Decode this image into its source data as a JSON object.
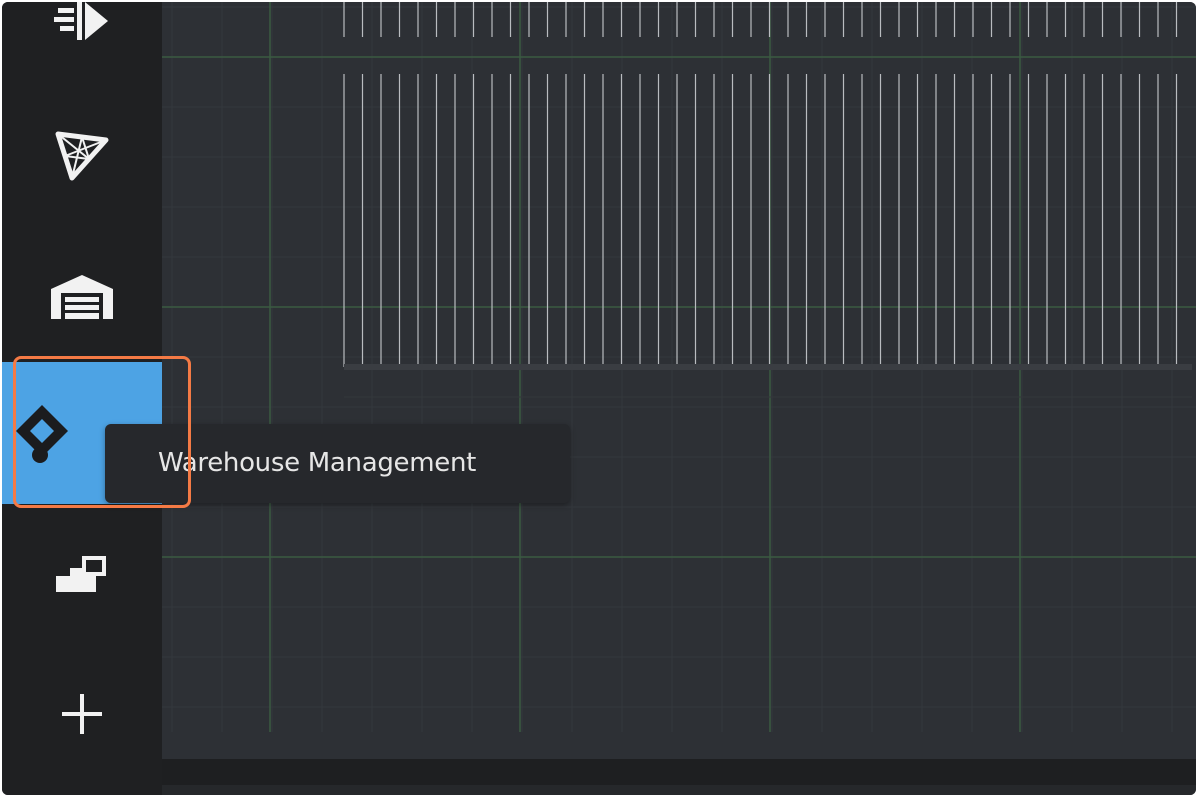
{
  "sidebar": {
    "items": [
      {
        "name": "nav-item-flow",
        "icon": "flow-arrow-icon",
        "active": false
      },
      {
        "name": "nav-item-mesh",
        "icon": "triangle-mesh-icon",
        "active": false
      },
      {
        "name": "nav-item-warehouse",
        "icon": "warehouse-icon",
        "active": false
      },
      {
        "name": "nav-item-warehouse-management",
        "icon": "diamond-connector-icon",
        "active": true
      },
      {
        "name": "nav-item-blocks",
        "icon": "blocks-icon",
        "active": false
      },
      {
        "name": "nav-item-add",
        "icon": "plus-icon",
        "active": false
      }
    ]
  },
  "tooltip": {
    "text": "Warehouse Management"
  },
  "colors": {
    "sidebar_bg": "#1f2022",
    "canvas_bg": "#2d3035",
    "active_item": "#4da3e4",
    "highlight": "#f47a45",
    "grid_major": "#3b5a42",
    "grid_minor": "#34383d",
    "rack_lines": "#b9bcc0"
  }
}
